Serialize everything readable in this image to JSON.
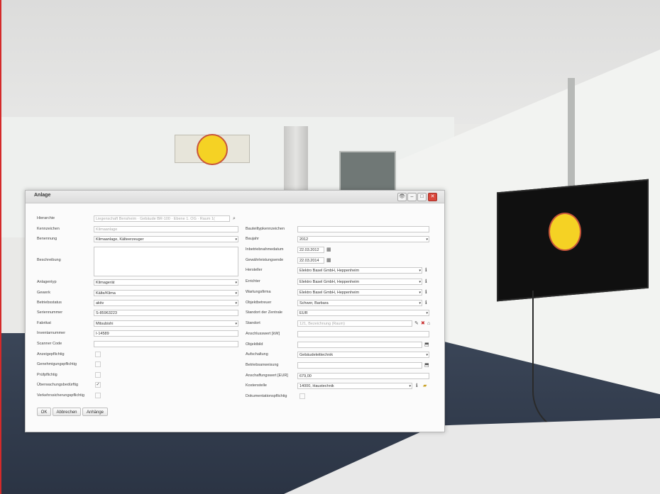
{
  "dialog": {
    "title": "Anlage",
    "window_buttons": [
      "👁",
      "–",
      "□",
      "✕"
    ],
    "fields_left": [
      {
        "label": "Hierarchie",
        "value": "Liegenschaft Bensheim · Gebäude BR-100 · Ebene 1. OG · Raum 1(",
        "placeholder": true,
        "type": "text",
        "suffix_icon": "search-icon"
      },
      {
        "label": "Kennzeichen",
        "value": "Klimaanlage",
        "placeholder": true,
        "type": "text"
      },
      {
        "label": "Benennung",
        "value": "Klimaanlage, Kälteerzeuger",
        "type": "select"
      },
      {
        "label": "Beschreibung",
        "value": "",
        "type": "textarea"
      },
      {
        "label": "Anlagentyp",
        "value": "Klimagerät",
        "type": "select"
      },
      {
        "label": "Gewerk",
        "value": "Kälte/Klima",
        "type": "select"
      },
      {
        "label": "Betriebsstatus",
        "value": "aktiv",
        "type": "select"
      },
      {
        "label": "Seriennummer",
        "value": "S-85963223",
        "type": "text"
      },
      {
        "label": "Fabrikat",
        "value": "Mitsubishi",
        "type": "select"
      },
      {
        "label": "Inventarnummer",
        "value": "I-14589",
        "type": "text"
      },
      {
        "label": "Scanner Code",
        "value": "",
        "type": "text"
      }
    ],
    "checks_left": [
      {
        "label": "Anzeigepflichtig",
        "checked": ""
      },
      {
        "label": "Genehmigungspflichtig",
        "checked": ""
      },
      {
        "label": "Prüfpflichtig",
        "checked": ""
      },
      {
        "label": "Überwachungsbedürftig",
        "checked": "✓"
      },
      {
        "label": "Verkehrssicherungspflichtig",
        "checked": ""
      }
    ],
    "fields_right": [
      {
        "label": "Bauteiltypkennzeichen",
        "value": "",
        "type": "text"
      },
      {
        "label": "Baujahr",
        "value": "2012",
        "type": "select"
      },
      {
        "label": "Inbetriebnahmedatum",
        "value": "22.03.2012",
        "type": "date"
      },
      {
        "label": "Gewährleistungsende",
        "value": "22.03.2014",
        "type": "date"
      },
      {
        "label": "Hersteller",
        "value": "Elektro Basel GmbH, Heppenheim",
        "type": "select-info"
      },
      {
        "label": "Errichter",
        "value": "Elektro Basel GmbH, Heppenheim",
        "type": "select-info"
      },
      {
        "label": "Wartungsfirma",
        "value": "Elektro Basel GmbH, Heppenheim",
        "type": "select-info"
      },
      {
        "label": "Objektbetreuer",
        "value": "Schwer, Barbara",
        "type": "select-info"
      },
      {
        "label": "Standort der Zentrale",
        "value": "EUR",
        "type": "select"
      },
      {
        "label": "Standort",
        "value": "121, Bezeichnung (Raum)",
        "placeholder": true,
        "type": "standort"
      },
      {
        "label": "Anschlusswert [kW]",
        "value": "",
        "type": "text"
      },
      {
        "label": "Objektbild",
        "value": "",
        "type": "file"
      },
      {
        "label": "Aufschaltung",
        "value": "Gebäudeleittechnik",
        "type": "select"
      },
      {
        "label": "Betriebsanweisung",
        "value": "",
        "type": "file"
      },
      {
        "label": "Anschaffungswert [EUR]",
        "value": "679,00",
        "type": "text"
      },
      {
        "label": "Kostenstelle",
        "value": "14000, Haustechnik",
        "type": "kosten"
      },
      {
        "label": "Dokumentationspflichtig",
        "value": "",
        "type": "check"
      }
    ],
    "buttons": {
      "ok": "OK",
      "cancel": "Abbrechen",
      "attachments": "Anhänge"
    }
  },
  "colors": {
    "accent_red": "#d9463a",
    "marker_yellow": "#f5d224"
  }
}
